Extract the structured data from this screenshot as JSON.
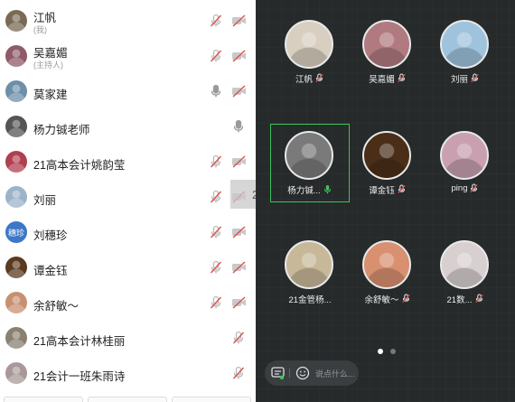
{
  "participants": [
    {
      "name": "江帆",
      "sub": "(我)",
      "mic": "muted",
      "cam": "off",
      "avatar": "#7a6a55"
    },
    {
      "name": "吴嘉媚",
      "sub": "(主持人)",
      "mic": "muted",
      "cam": "off",
      "avatar": "#8f5a6a"
    },
    {
      "name": "莫家建",
      "sub": "",
      "mic": "on",
      "cam": "off",
      "avatar": "#6d8fa8"
    },
    {
      "name": "杨力铖老师",
      "sub": "",
      "mic": "on",
      "cam": "none",
      "avatar": "#555555"
    },
    {
      "name": "21高本会计姚韵莹",
      "sub": "",
      "mic": "muted",
      "cam": "off",
      "avatar": "#b04050"
    },
    {
      "name": "刘丽",
      "sub": "",
      "mic": "muted",
      "cam": "off",
      "avatar": "#9cb4c8"
    },
    {
      "name": "刘穗珍",
      "sub": "",
      "mic": "muted",
      "cam": "off",
      "avatar": "#3d78c8",
      "badge": "穗珍"
    },
    {
      "name": "谭金钰",
      "sub": "",
      "mic": "muted",
      "cam": "off",
      "avatar": "#5a3a20"
    },
    {
      "name": "余舒敏～",
      "sub": "",
      "mic": "muted",
      "cam": "off",
      "avatar": "#c89070"
    },
    {
      "name": "21高本会计林桂丽",
      "sub": "",
      "mic": "muted",
      "cam": "none",
      "avatar": "#8a8070"
    },
    {
      "name": "21会计一班朱雨诗",
      "sub": "",
      "mic": "muted",
      "cam": "none",
      "avatar": "#a89898"
    }
  ],
  "overlay_percent": "25%",
  "tiles": [
    {
      "name": "江帆",
      "mic": "muted",
      "color": "#d8cfc0"
    },
    {
      "name": "吴嘉媚",
      "mic": "muted",
      "color": "#b07a80"
    },
    {
      "name": "刘丽",
      "mic": "muted",
      "color": "#9fc3dd"
    },
    {
      "name": "杨力铖...",
      "mic": "on",
      "color": "#7a7a7a"
    },
    {
      "name": "谭金钰",
      "mic": "muted",
      "color": "#4a2e18"
    },
    {
      "name": "ping",
      "mic": "muted",
      "color": "#c8a0b0"
    },
    {
      "name": "21金管杨...",
      "mic": "none",
      "color": "#c8b89a"
    },
    {
      "name": "余舒敏～",
      "mic": "muted",
      "color": "#d89070"
    },
    {
      "name": "21数...",
      "mic": "muted",
      "color": "#d8d0d0"
    }
  ],
  "chat": {
    "placeholder": "说点什么..."
  },
  "colors": {
    "active": "#3cc35a",
    "muted_red": "#d9534f",
    "mic_gray": "#9a9a9a",
    "mic_green": "#3cc35a"
  },
  "icons": {
    "mic": "mic-icon",
    "mic_off": "mic-off-icon",
    "cam_off": "camera-off-icon",
    "chat": "chat-icon",
    "emoji": "emoji-icon"
  }
}
